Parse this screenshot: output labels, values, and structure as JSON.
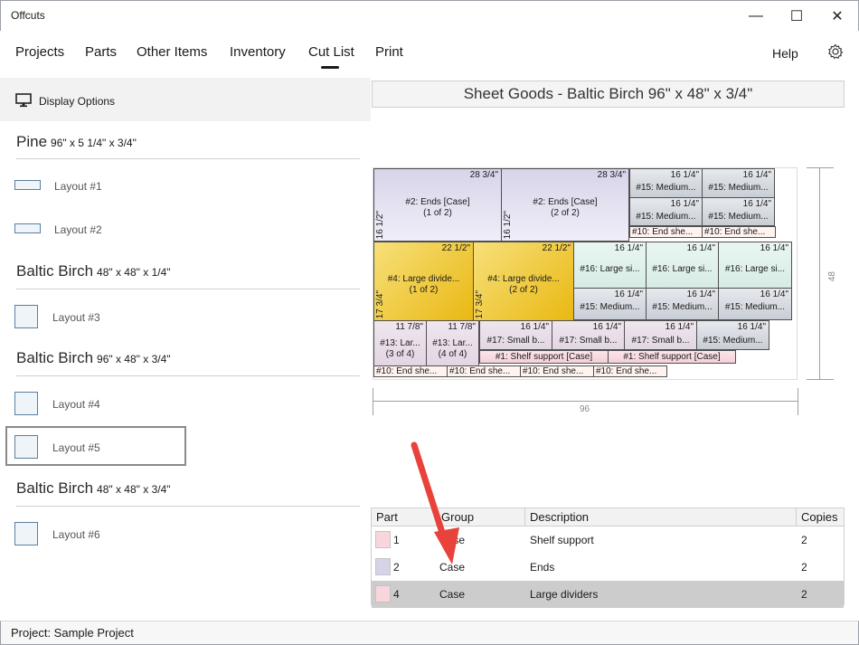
{
  "app": {
    "title": "Offcuts"
  },
  "window_controls": {
    "minimize": "—",
    "maximize": "☐",
    "close": "✕"
  },
  "menu": {
    "items": [
      "Projects",
      "Parts",
      "Other Items",
      "Inventory",
      "Cut List",
      "Print"
    ],
    "active": "Cut List",
    "help": "Help"
  },
  "left": {
    "display_options": "Display Options",
    "groups": [
      {
        "material": "Pine",
        "dims": "96\" x 5 1/4\" x  3/4\"",
        "layouts": [
          "Layout #1",
          "Layout #2"
        ]
      },
      {
        "material": "Baltic Birch",
        "dims": "48\" x 48\" x  1/4\"",
        "layouts": [
          "Layout #3"
        ]
      },
      {
        "material": "Baltic Birch",
        "dims": "96\" x 48\" x  3/4\"",
        "layouts": [
          "Layout #4",
          "Layout #5"
        ]
      },
      {
        "material": "Baltic Birch",
        "dims": "48\" x 48\" x  3/4\"",
        "layouts": [
          "Layout #6"
        ]
      }
    ],
    "selected_layout": "Layout #5"
  },
  "sheet": {
    "title": "Sheet Goods - Baltic Birch  96\" x 48\" x  3/4\"",
    "width_label": "96",
    "height_label": "48",
    "parts": {
      "p1": {
        "w": "28 3/4\"",
        "n1": "#2: Ends [Case]",
        "n2": "(1 of 2)",
        "h": "16 1/2\""
      },
      "p2": {
        "w": "28 3/4\"",
        "n1": "#2: Ends [Case]",
        "n2": "(2 of 2)",
        "h": "16 1/2\""
      },
      "p3": {
        "w": "16 1/4\"",
        "n1": "#15: Medium..."
      },
      "p4": {
        "w": "16 1/4\"",
        "n1": "#15: Medium..."
      },
      "p5": {
        "w": "16 1/4\"",
        "n1": "#15: Medium..."
      },
      "p6": {
        "w": "16 1/4\"",
        "n1": "#15: Medium..."
      },
      "p7": {
        "n1": "#10: End she..."
      },
      "p8": {
        "n1": "#10: End she..."
      },
      "p9": {
        "w": "22 1/2\"",
        "n1": "#4: Large divide...",
        "n2": "(1 of 2)",
        "h": "17 3/4\""
      },
      "p10": {
        "w": "22 1/2\"",
        "n1": "#4: Large divide...",
        "n2": "(2 of 2)",
        "h": "17 3/4\""
      },
      "p11": {
        "w": "16 1/4\"",
        "n1": "#16: Large si..."
      },
      "p12": {
        "w": "16 1/4\"",
        "n1": "#16: Large si..."
      },
      "p13": {
        "w": "16 1/4\"",
        "n1": "#16: Large si..."
      },
      "p14": {
        "w": "16 1/4\"",
        "n1": "#15: Medium..."
      },
      "p15": {
        "w": "16 1/4\"",
        "n1": "#15: Medium..."
      },
      "p16": {
        "w": "16 1/4\"",
        "n1": "#15: Medium..."
      },
      "p17": {
        "w": "11 7/8\"",
        "n1": "#13: Lar...",
        "n2": "(3 of 4)"
      },
      "p18": {
        "w": "11 7/8\"",
        "n1": "#13: Lar...",
        "n2": "(4 of 4)"
      },
      "p19": {
        "w": "16 1/4\"",
        "n1": "#17: Small b..."
      },
      "p20": {
        "w": "16 1/4\"",
        "n1": "#17: Small b..."
      },
      "p21": {
        "w": "16 1/4\"",
        "n1": "#17: Small b..."
      },
      "p22": {
        "w": "16 1/4\"",
        "n1": "#15: Medium..."
      },
      "p23": {
        "n1": "#1: Shelf support [Case]"
      },
      "p24": {
        "n1": "#1: Shelf support [Case]"
      },
      "p25": {
        "n1": "#10: End she..."
      },
      "p26": {
        "n1": "#10: End she..."
      },
      "p27": {
        "n1": "#10: End she..."
      },
      "p28": {
        "n1": "#10: End she..."
      }
    }
  },
  "table": {
    "headers": [
      "Part",
      "Group",
      "Description",
      "Copies"
    ],
    "rows": [
      {
        "part": "1",
        "group": "Case",
        "description": "Shelf support",
        "copies": "2",
        "color": "#f9d6dc"
      },
      {
        "part": "2",
        "group": "Case",
        "description": "Ends",
        "copies": "2",
        "color": "#d6d3e8"
      },
      {
        "part": "4",
        "group": "Case",
        "description": "Large dividers",
        "copies": "2",
        "color": "#f9d6dc"
      }
    ],
    "selected_row": "4"
  },
  "status": {
    "project": "Project: Sample Project"
  },
  "colors": {
    "accent_arrow": "#e8423a",
    "selection": "#cccccc"
  }
}
